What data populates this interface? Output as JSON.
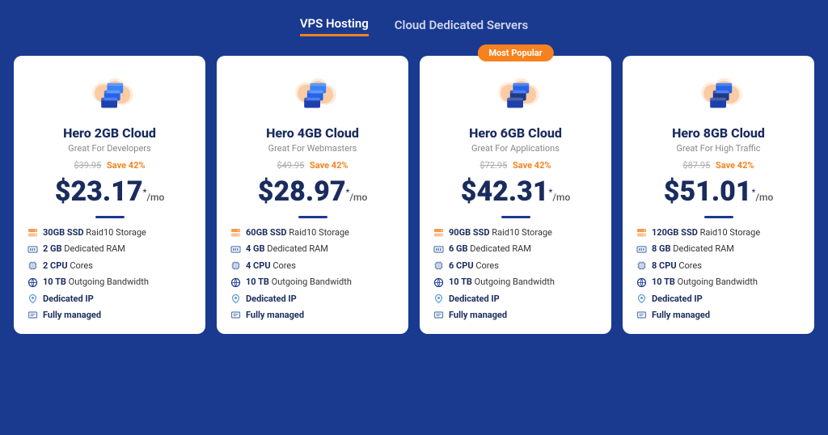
{
  "tabs": [
    {
      "label": "VPS Hosting",
      "active": true
    },
    {
      "label": "Cloud Dedicated Servers",
      "active": false
    }
  ],
  "plans": [
    {
      "id": "hero-2gb",
      "name": "Hero 2GB Cloud",
      "tagline": "Great For Developers",
      "original_price": "$39.95",
      "save": "Save 42%",
      "price": "$23.17",
      "per_mo": "/mo",
      "popular": false,
      "features": [
        {
          "icon": "storage",
          "bold": "30GB SSD",
          "text": " Raid10 Storage"
        },
        {
          "icon": "ram",
          "bold": "2 GB",
          "text": " Dedicated RAM"
        },
        {
          "icon": "cpu",
          "bold": "2 CPU",
          "text": " Cores"
        },
        {
          "icon": "bw",
          "bold": "10 TB",
          "text": " Outgoing Bandwidth"
        },
        {
          "icon": "ip",
          "bold": "Dedicated IP",
          "text": ""
        },
        {
          "icon": "managed",
          "bold": "Fully managed",
          "text": ""
        }
      ]
    },
    {
      "id": "hero-4gb",
      "name": "Hero 4GB Cloud",
      "tagline": "Great For Webmasters",
      "original_price": "$49.95",
      "save": "Save 42%",
      "price": "$28.97",
      "per_mo": "/mo",
      "popular": false,
      "features": [
        {
          "icon": "storage",
          "bold": "60GB SSD",
          "text": " Raid10 Storage"
        },
        {
          "icon": "ram",
          "bold": "4 GB",
          "text": " Dedicated RAM"
        },
        {
          "icon": "cpu",
          "bold": "4 CPU",
          "text": " Cores"
        },
        {
          "icon": "bw",
          "bold": "10 TB",
          "text": " Outgoing Bandwidth"
        },
        {
          "icon": "ip",
          "bold": "Dedicated IP",
          "text": ""
        },
        {
          "icon": "managed",
          "bold": "Fully managed",
          "text": ""
        }
      ]
    },
    {
      "id": "hero-6gb",
      "name": "Hero 6GB Cloud",
      "tagline": "Great For Applications",
      "original_price": "$72.95",
      "save": "Save 42%",
      "price": "$42.31",
      "per_mo": "/mo",
      "popular": true,
      "popular_label": "Most Popular",
      "features": [
        {
          "icon": "storage",
          "bold": "90GB SSD",
          "text": " Raid10 Storage"
        },
        {
          "icon": "ram",
          "bold": "6 GB",
          "text": " Dedicated RAM"
        },
        {
          "icon": "cpu",
          "bold": "6 CPU",
          "text": " Cores"
        },
        {
          "icon": "bw",
          "bold": "10 TB",
          "text": " Outgoing Bandwidth"
        },
        {
          "icon": "ip",
          "bold": "Dedicated IP",
          "text": ""
        },
        {
          "icon": "managed",
          "bold": "Fully managed",
          "text": ""
        }
      ]
    },
    {
      "id": "hero-8gb",
      "name": "Hero 8GB Cloud",
      "tagline": "Great For High Traffic",
      "original_price": "$87.95",
      "save": "Save 42%",
      "price": "$51.01",
      "per_mo": "/mo",
      "popular": false,
      "features": [
        {
          "icon": "storage",
          "bold": "120GB SSD",
          "text": " Raid10 Storage"
        },
        {
          "icon": "ram",
          "bold": "8 GB",
          "text": " Dedicated RAM"
        },
        {
          "icon": "cpu",
          "bold": "8 CPU",
          "text": " Cores"
        },
        {
          "icon": "bw",
          "bold": "10 TB",
          "text": " Outgoing Bandwidth"
        },
        {
          "icon": "ip",
          "bold": "Dedicated IP",
          "text": ""
        },
        {
          "icon": "managed",
          "bold": "Fully managed",
          "text": ""
        }
      ]
    }
  ]
}
